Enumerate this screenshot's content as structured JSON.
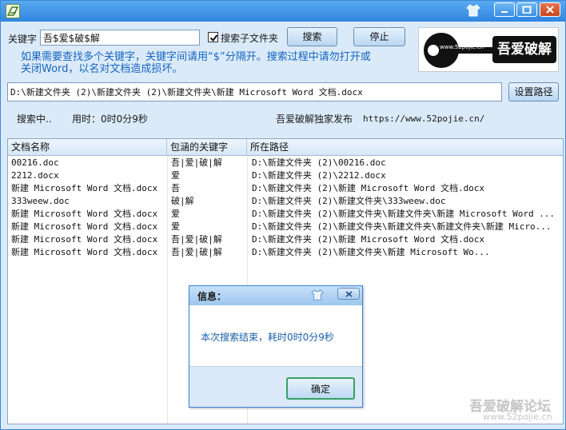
{
  "window": {
    "icon": "app-icon",
    "controls": [
      "shirt-icon",
      "minimize-icon",
      "maximize-icon",
      "close-icon"
    ]
  },
  "search": {
    "keyword_label": "关键字",
    "keyword_value": "吾$爱$破$解",
    "subfolder_label": "搜索子文件夹",
    "subfolder_checked": true,
    "search_button": "搜索",
    "stop_button": "停止",
    "hint_line1": "如果需要查找多个关键字，关键字间请用“$”分隔开。搜索过程中请勿打开或",
    "hint_line2": "关闭Word，以名对文档造成损坏。"
  },
  "logo": {
    "url": "www.52pojie.cn",
    "text": "吾爱破解"
  },
  "path": {
    "value": "D:\\新建文件夹 (2)\\新建文件夹 (2)\\新建文件夹\\新建 Microsoft Word 文档.docx",
    "set_path_button": "设置路径"
  },
  "status": {
    "state": "搜索中..",
    "elapsed": "用时：0时0分9秒",
    "publisher": "吾爱破解独家发布",
    "url": "https://www.52pojie.cn/"
  },
  "table": {
    "headers": [
      "文档名称",
      "包涵的关键字",
      "所在路径"
    ],
    "rows": [
      [
        "00216.doc",
        "吾|爱|破|解",
        "D:\\新建文件夹 (2)\\00216.doc"
      ],
      [
        "2212.docx",
        "爱",
        "D:\\新建文件夹 (2)\\2212.docx"
      ],
      [
        "新建 Microsoft Word 文档.docx",
        "吾",
        "D:\\新建文件夹 (2)\\新建 Microsoft Word 文档.docx"
      ],
      [
        "333weew.doc",
        "破|解",
        "D:\\新建文件夹 (2)\\新建文件夹\\333weew.doc"
      ],
      [
        "新建 Microsoft Word 文档.docx",
        "爱",
        "D:\\新建文件夹 (2)\\新建文件夹\\新建文件夹\\新建 Microsoft Word ..."
      ],
      [
        "新建 Microsoft Word 文档.docx",
        "爱",
        "D:\\新建文件夹 (2)\\新建文件夹\\新建文件夹\\新建文件夹\\新建 Micro..."
      ],
      [
        "新建 Microsoft Word 文档.docx",
        "吾|爱|破|解",
        "D:\\新建文件夹 (2)\\新建 Microsoft Word 文档.docx"
      ],
      [
        "新建 Microsoft Word 文档.docx",
        "吾|爱|破|解",
        "D:\\新建文件夹 (2)\\新建文件夹\\新建 Microsoft Wo..."
      ]
    ]
  },
  "dialog": {
    "title": "信息：",
    "message": "本次搜索结束，耗时0时0分9秒",
    "ok_button": "确定"
  },
  "watermark": {
    "text": "吾爱破解论坛",
    "url": "www.52pojie.cn"
  },
  "colors": {
    "title_bar": "#3f95e8",
    "hint_text": "#1565c0",
    "window_bg": "#dbeaf8"
  }
}
